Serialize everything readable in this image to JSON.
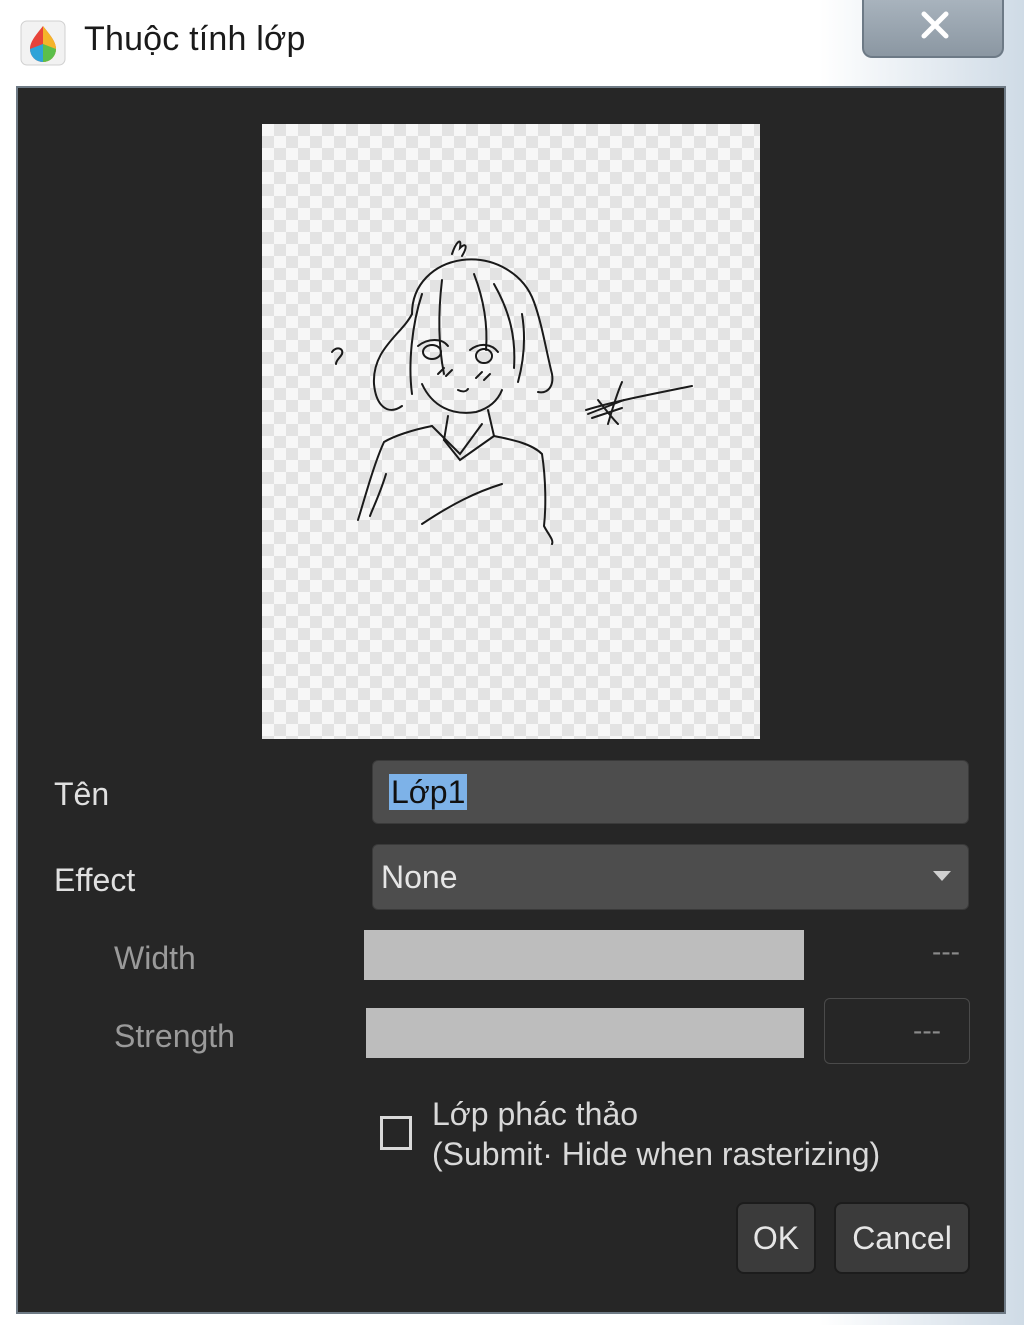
{
  "window": {
    "title": "Thuộc tính lớp"
  },
  "form": {
    "name_label": "Tên",
    "name_value": "Lớp1",
    "effect_label": "Effect",
    "effect_value": "None",
    "width_label": "Width",
    "width_value": "---",
    "strength_label": "Strength",
    "strength_value": "---",
    "draft_label_line1": "Lớp phác thảo",
    "draft_label_line2": "(Submit· Hide when rasterizing)",
    "draft_checked": false
  },
  "buttons": {
    "ok_label": "OK",
    "cancel_label": "Cancel"
  },
  "colors": {
    "dialog_background": "#262626",
    "field_background": "#4d4d4d",
    "selection_highlight": "#7db2e8",
    "slider_fill": "#bdbdbd"
  },
  "icons": {
    "app": "medibang-app-icon",
    "close": "close-icon",
    "dropdown": "chevron-down-icon"
  }
}
